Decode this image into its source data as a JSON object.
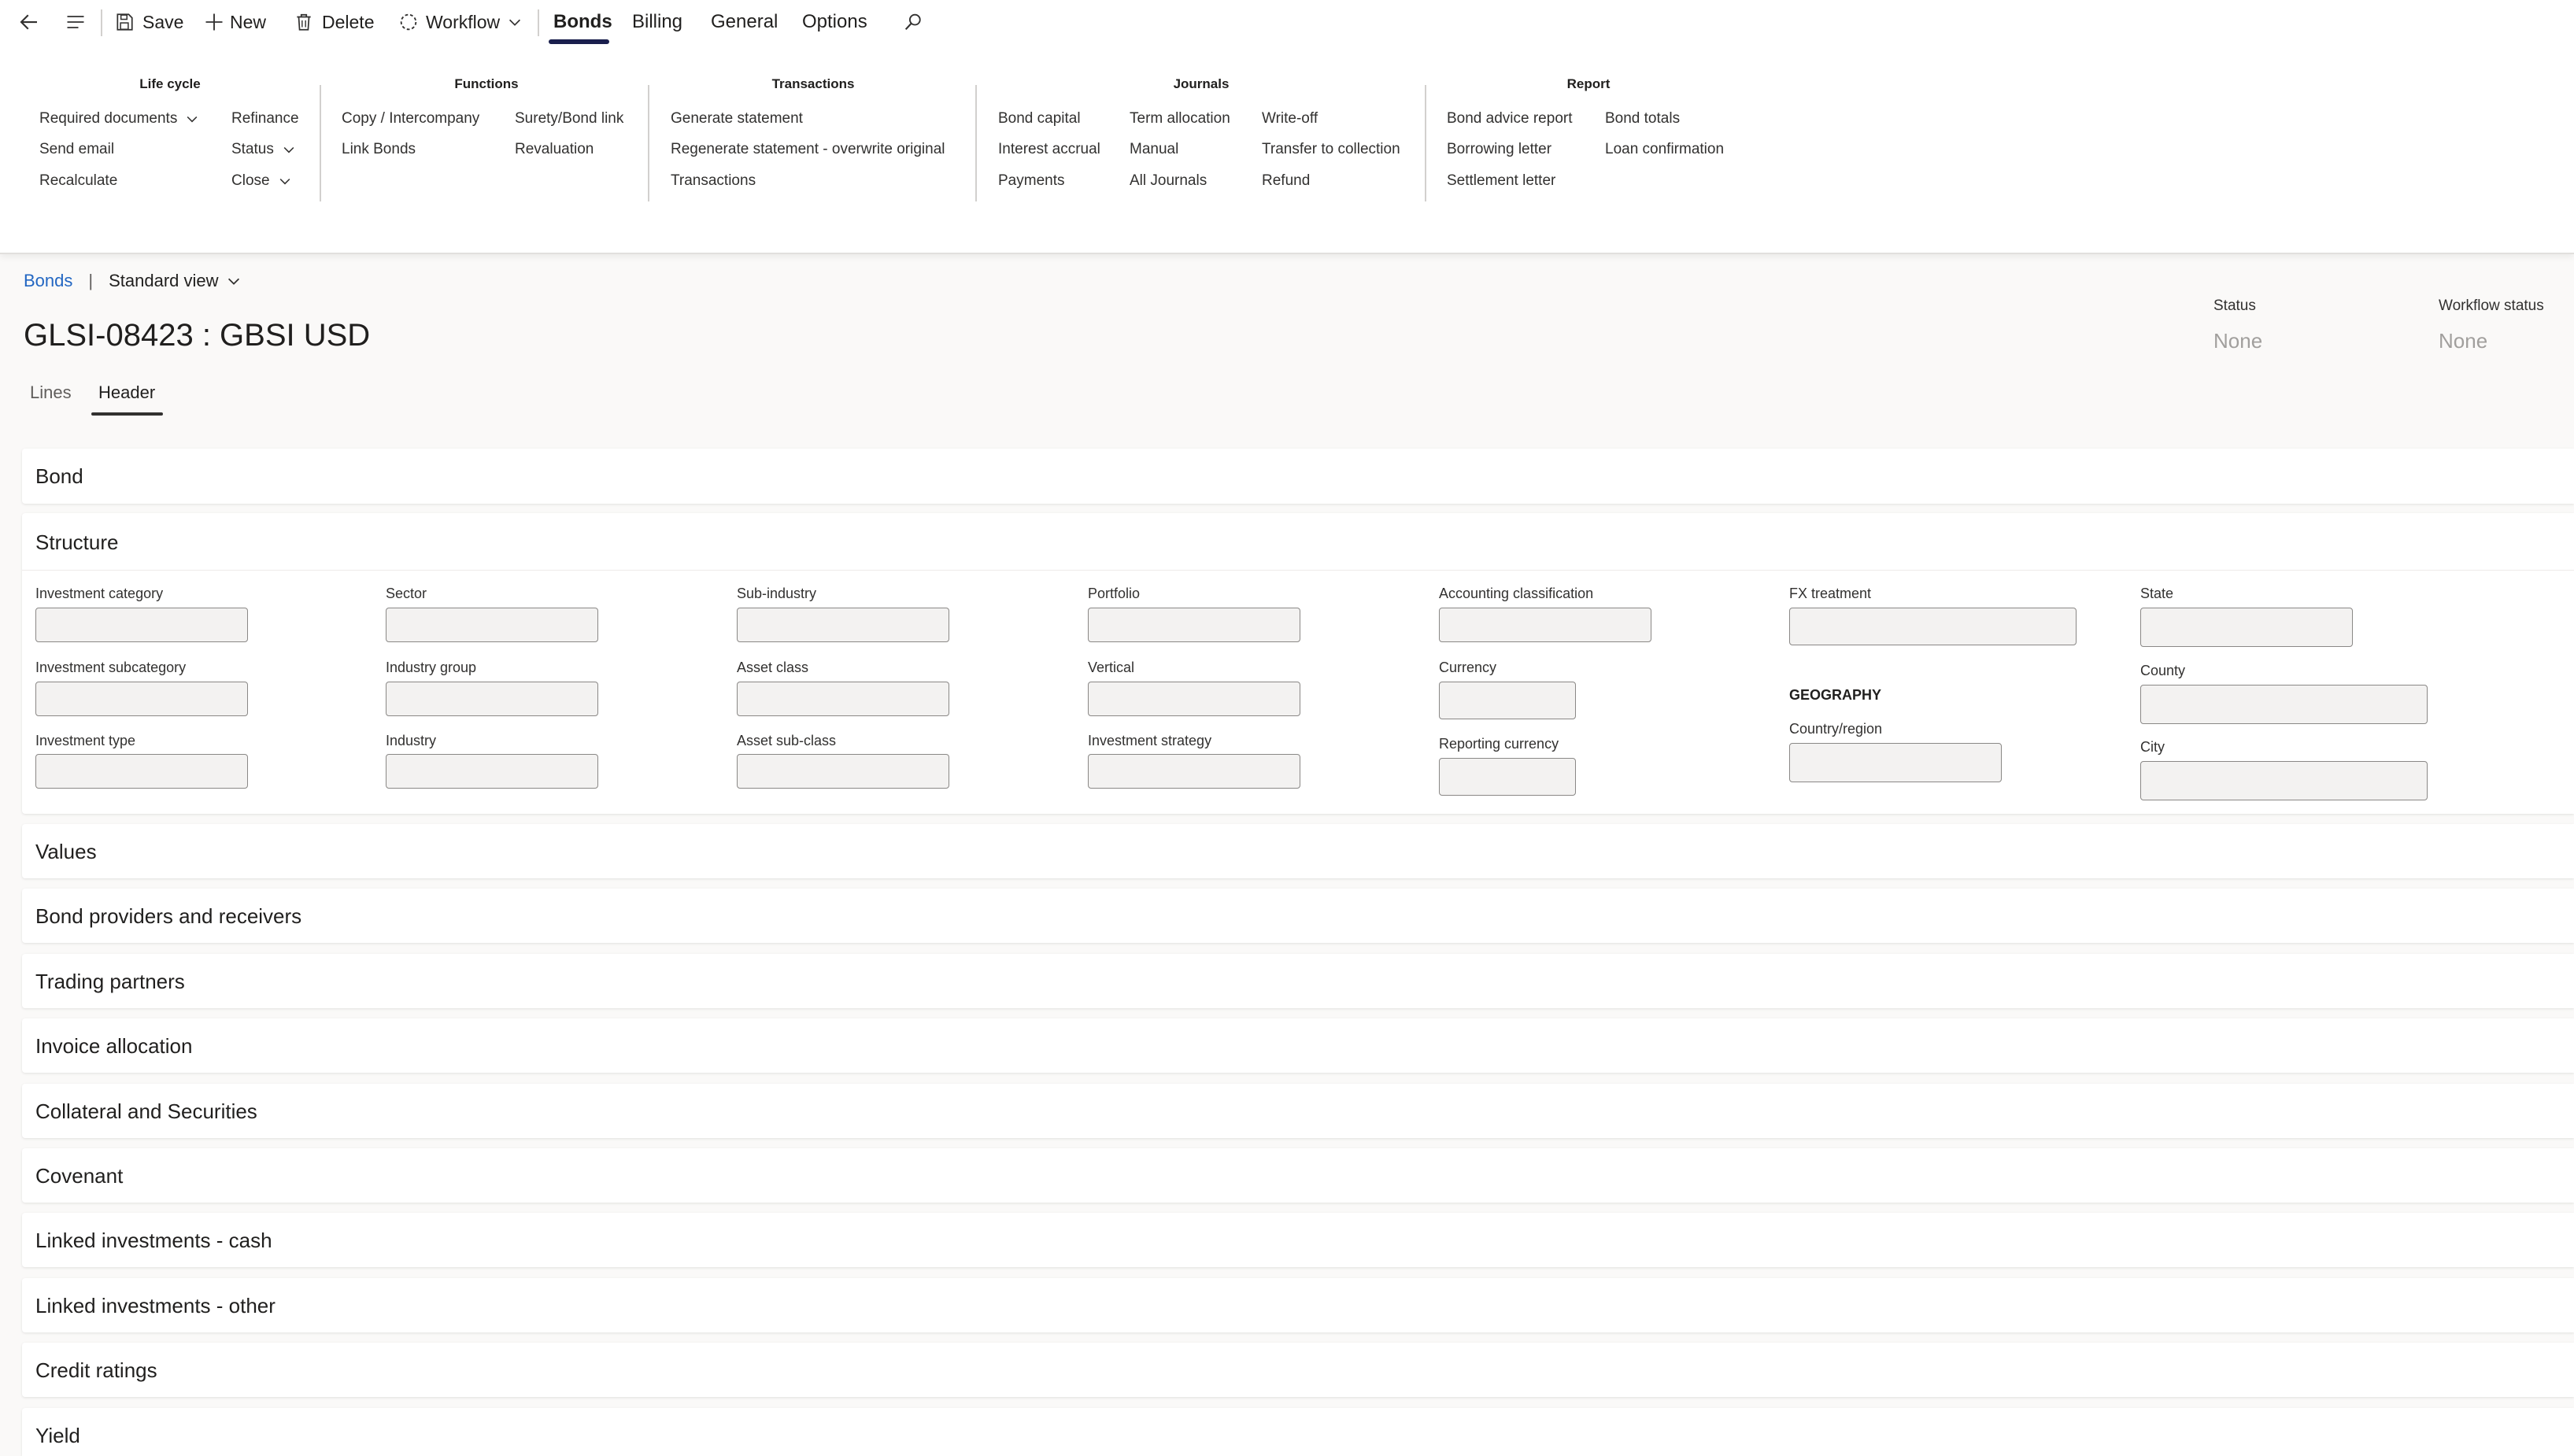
{
  "toolbar": {
    "save_label": "Save",
    "new_label": "New",
    "delete_label": "Delete",
    "workflow_label": "Workflow",
    "tabs": [
      "Bonds",
      "Billing",
      "General",
      "Options"
    ],
    "active_tab": "Bonds"
  },
  "ribbon": {
    "groups": [
      {
        "title": "Life cycle",
        "items": [
          "Required documents",
          "Send email",
          "Recalculate",
          "Refinance",
          "Status",
          "Close"
        ]
      },
      {
        "title": "Functions",
        "items": [
          "Copy / Intercompany",
          "Link Bonds",
          "Surety/Bond link",
          "Revaluation"
        ]
      },
      {
        "title": "Transactions",
        "items": [
          "Generate statement",
          "Regenerate statement - overwrite original",
          "Transactions"
        ]
      },
      {
        "title": "Journals",
        "items": [
          "Bond capital",
          "Interest accrual",
          "Payments",
          "Term allocation",
          "Manual",
          "All Journals",
          "Write-off",
          "Transfer to collection",
          "Refund"
        ]
      },
      {
        "title": "Report",
        "items": [
          "Bond advice report",
          "Borrowing letter",
          "Settlement letter",
          "Bond totals",
          "Loan confirmation"
        ]
      }
    ]
  },
  "breadcrumb": {
    "link": "Bonds",
    "separator": "|",
    "view": "Standard view"
  },
  "record": {
    "title": "GLSI-08423 : GBSI USD",
    "status_label": "Status",
    "status_value": "None",
    "workflow_status_label": "Workflow status",
    "workflow_status_value": "None"
  },
  "page_tabs": [
    "Lines",
    "Header"
  ],
  "active_page_tab": "Header",
  "sections": {
    "bond": "Bond",
    "structure": "Structure",
    "values": "Values",
    "providers": "Bond providers and receivers",
    "trading": "Trading partners",
    "invoice": "Invoice allocation",
    "collateral": "Collateral and Securities",
    "covenant": "Covenant",
    "linked_cash": "Linked investments - cash",
    "linked_other": "Linked investments - other",
    "credit": "Credit ratings",
    "yield": "Yield"
  },
  "structure_fields": {
    "investment_category": {
      "label": "Investment category",
      "value": ""
    },
    "investment_subcategory": {
      "label": "Investment subcategory",
      "value": ""
    },
    "investment_type": {
      "label": "Investment type",
      "value": ""
    },
    "sector": {
      "label": "Sector",
      "value": ""
    },
    "industry_group": {
      "label": "Industry group",
      "value": ""
    },
    "industry": {
      "label": "Industry",
      "value": ""
    },
    "sub_industry": {
      "label": "Sub-industry",
      "value": ""
    },
    "asset_class": {
      "label": "Asset class",
      "value": ""
    },
    "asset_sub_class": {
      "label": "Asset sub-class",
      "value": ""
    },
    "portfolio": {
      "label": "Portfolio",
      "value": ""
    },
    "vertical": {
      "label": "Vertical",
      "value": ""
    },
    "investment_strategy": {
      "label": "Investment strategy",
      "value": ""
    },
    "accounting_classification": {
      "label": "Accounting classification",
      "value": ""
    },
    "currency": {
      "label": "Currency",
      "value": ""
    },
    "reporting_currency": {
      "label": "Reporting currency",
      "value": ""
    },
    "fx_treatment": {
      "label": "FX treatment",
      "value": ""
    },
    "geography_heading": "GEOGRAPHY",
    "country_region": {
      "label": "Country/region",
      "value": ""
    },
    "state": {
      "label": "State",
      "value": ""
    },
    "county": {
      "label": "County",
      "value": ""
    },
    "city": {
      "label": "City",
      "value": ""
    }
  }
}
